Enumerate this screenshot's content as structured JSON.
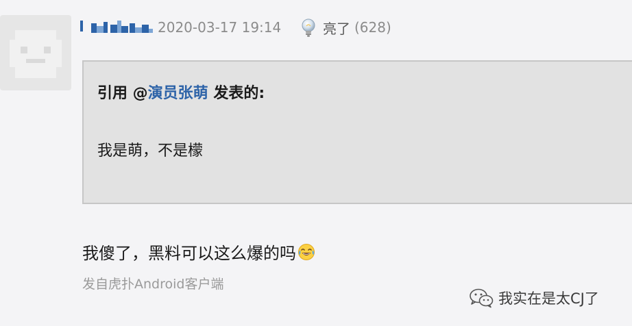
{
  "post": {
    "username": "",
    "timestamp": "2020-03-17 19:14",
    "like_label": "亮了",
    "like_count": "(628)",
    "quote": {
      "prefix": "引用 @",
      "author": "演员张萌",
      "suffix": " 发表的:",
      "body": "我是萌，不是檬"
    },
    "reply_text": "我傻了，黑料可以这么爆的吗",
    "source": "发自虎扑Android客户端"
  },
  "watermark": {
    "text": "我实在是太CJ了"
  },
  "colors": {
    "link_blue": "#2d63a8",
    "quote_bg": "#e2e2e2",
    "meta_gray": "#8b8b8b"
  },
  "icons": {
    "like": "lightbulb-icon",
    "emoji": "tears-of-joy-emoji-icon",
    "watermark": "wechat-icon"
  }
}
